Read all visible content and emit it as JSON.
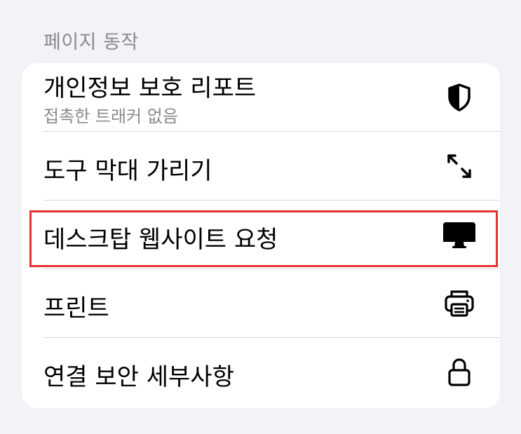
{
  "section_header": "페이지 동작",
  "menu": {
    "items": [
      {
        "label": "개인정보 보호 리포트",
        "sublabel": "접촉한 트래커 없음",
        "icon": "shield-icon"
      },
      {
        "label": "도구 막대 가리기",
        "icon": "expand-arrows-icon"
      },
      {
        "label": "데스크탑 웹사이트 요청",
        "icon": "desktop-icon"
      },
      {
        "label": "프린트",
        "icon": "printer-icon"
      },
      {
        "label": "연결 보안 세부사항",
        "icon": "lock-icon"
      }
    ]
  },
  "colors": {
    "background": "#f2f2f7",
    "card": "#ffffff",
    "highlight_border": "#e53238",
    "secondary_text": "#8a8a8e"
  }
}
